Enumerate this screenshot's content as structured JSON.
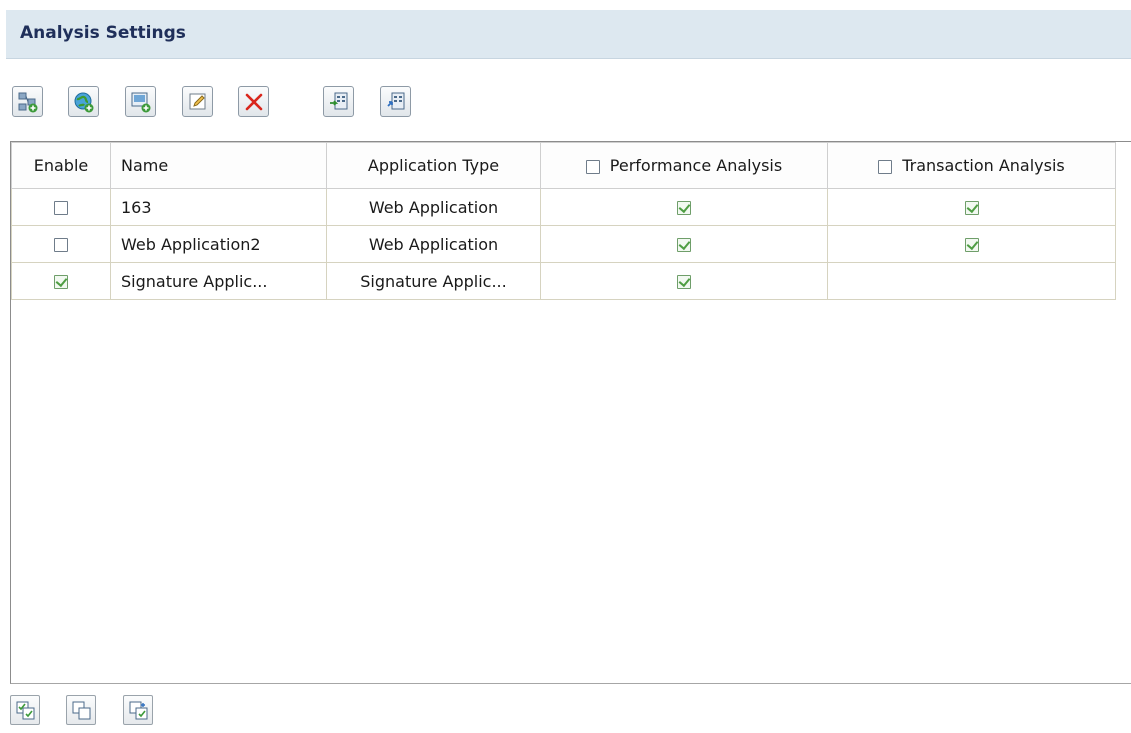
{
  "header": {
    "title": "Analysis Settings"
  },
  "toolbar": {
    "buttons": [
      {
        "name": "add-server-button",
        "icon": "network-add-icon"
      },
      {
        "name": "add-web-application-button",
        "icon": "globe-add-icon"
      },
      {
        "name": "add-signature-application-button",
        "icon": "screen-add-icon"
      },
      {
        "name": "edit-button",
        "icon": "edit-icon"
      },
      {
        "name": "delete-button",
        "icon": "delete-x-icon",
        "color": "#d9261c"
      },
      {
        "name": "import-button",
        "icon": "import-icon"
      },
      {
        "name": "export-button",
        "icon": "export-icon"
      }
    ]
  },
  "table": {
    "headers": {
      "enable": "Enable",
      "name": "Name",
      "app_type": "Application Type",
      "performance": "Performance Analysis",
      "transaction": "Transaction Analysis"
    },
    "header_checks": {
      "performance": false,
      "transaction": false
    },
    "rows": [
      {
        "enabled": false,
        "name": "163",
        "app_type": "Web Application",
        "performance": true,
        "transaction": true
      },
      {
        "enabled": false,
        "name": "Web Application2",
        "app_type": "Web Application",
        "performance": true,
        "transaction": true
      },
      {
        "enabled": true,
        "name": "Signature Applic...",
        "app_type": "Signature Applic...",
        "performance": true,
        "transaction": null
      }
    ]
  },
  "bottom_toolbar": {
    "buttons": [
      {
        "name": "select-all-button",
        "icon": "select-all-icon"
      },
      {
        "name": "deselect-all-button",
        "icon": "deselect-all-icon"
      },
      {
        "name": "invert-selection-button",
        "icon": "invert-selection-icon"
      }
    ]
  },
  "colors": {
    "header_bg": "#dde8f0",
    "title": "#1f2f5a",
    "check": "#4f9e43",
    "delete": "#d9261c"
  }
}
